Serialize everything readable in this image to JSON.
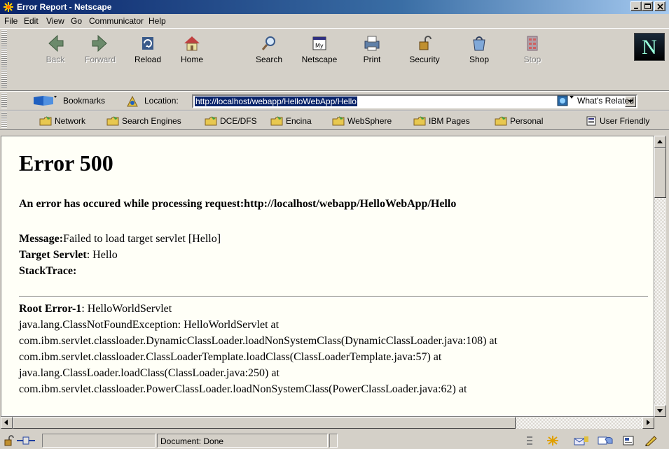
{
  "window": {
    "title": "Error Report - Netscape"
  },
  "menu": [
    "File",
    "Edit",
    "View",
    "Go",
    "Communicator",
    "Help"
  ],
  "nav_toolbar": [
    {
      "label": "Back",
      "icon": "back-arrow-icon",
      "enabled": false
    },
    {
      "label": "Forward",
      "icon": "forward-arrow-icon",
      "enabled": false
    },
    {
      "label": "Reload",
      "icon": "reload-icon",
      "enabled": true
    },
    {
      "label": "Home",
      "icon": "home-icon",
      "enabled": true
    },
    {
      "label": "Search",
      "icon": "search-icon",
      "enabled": true
    },
    {
      "label": "Netscape",
      "icon": "my-netscape-icon",
      "enabled": true
    },
    {
      "label": "Print",
      "icon": "print-icon",
      "enabled": true
    },
    {
      "label": "Security",
      "icon": "lock-icon",
      "enabled": true
    },
    {
      "label": "Shop",
      "icon": "shop-icon",
      "enabled": true
    },
    {
      "label": "Stop",
      "icon": "stop-icon",
      "enabled": false
    }
  ],
  "netscape_logo": "N",
  "location_bar": {
    "bookmarks_label": "Bookmarks",
    "location_label": "Location:",
    "url": "http://localhost/webapp/HelloWebApp/Hello",
    "related_label": "What's Related"
  },
  "personal_toolbar": [
    "Network",
    "Search Engines",
    "DCE/DFS",
    "Encina",
    "WebSphere",
    "IBM Pages",
    "Personal",
    "User Friendly"
  ],
  "page": {
    "heading": "Error 500",
    "request_line": "An error has occured while processing request:http://localhost/webapp/HelloWebApp/Hello",
    "message_label": "Message:",
    "message_value": "Failed to load target servlet [Hello]",
    "target_label": "Target Servlet",
    "target_value": ": Hello",
    "stacktrace_label": "StackTrace:",
    "root_error_label": "Root Error-1",
    "root_error_value": ": HelloWorldServlet",
    "trace": [
      "java.lang.ClassNotFoundException: HelloWorldServlet at",
      "com.ibm.servlet.classloader.DynamicClassLoader.loadNonSystemClass(DynamicClassLoader.java:108) at",
      "com.ibm.servlet.classloader.ClassLoaderTemplate.loadClass(ClassLoaderTemplate.java:57) at",
      "java.lang.ClassLoader.loadClass(ClassLoader.java:250) at",
      "com.ibm.servlet.classloader.PowerClassLoader.loadNonSystemClass(PowerClassLoader.java:62) at"
    ]
  },
  "status_bar": {
    "text": "Document: Done"
  },
  "colors": {
    "titlebar": "#0a246a",
    "selection": "#0a246a",
    "chrome": "#d4d0c8",
    "page_bg": "#fffff7"
  }
}
